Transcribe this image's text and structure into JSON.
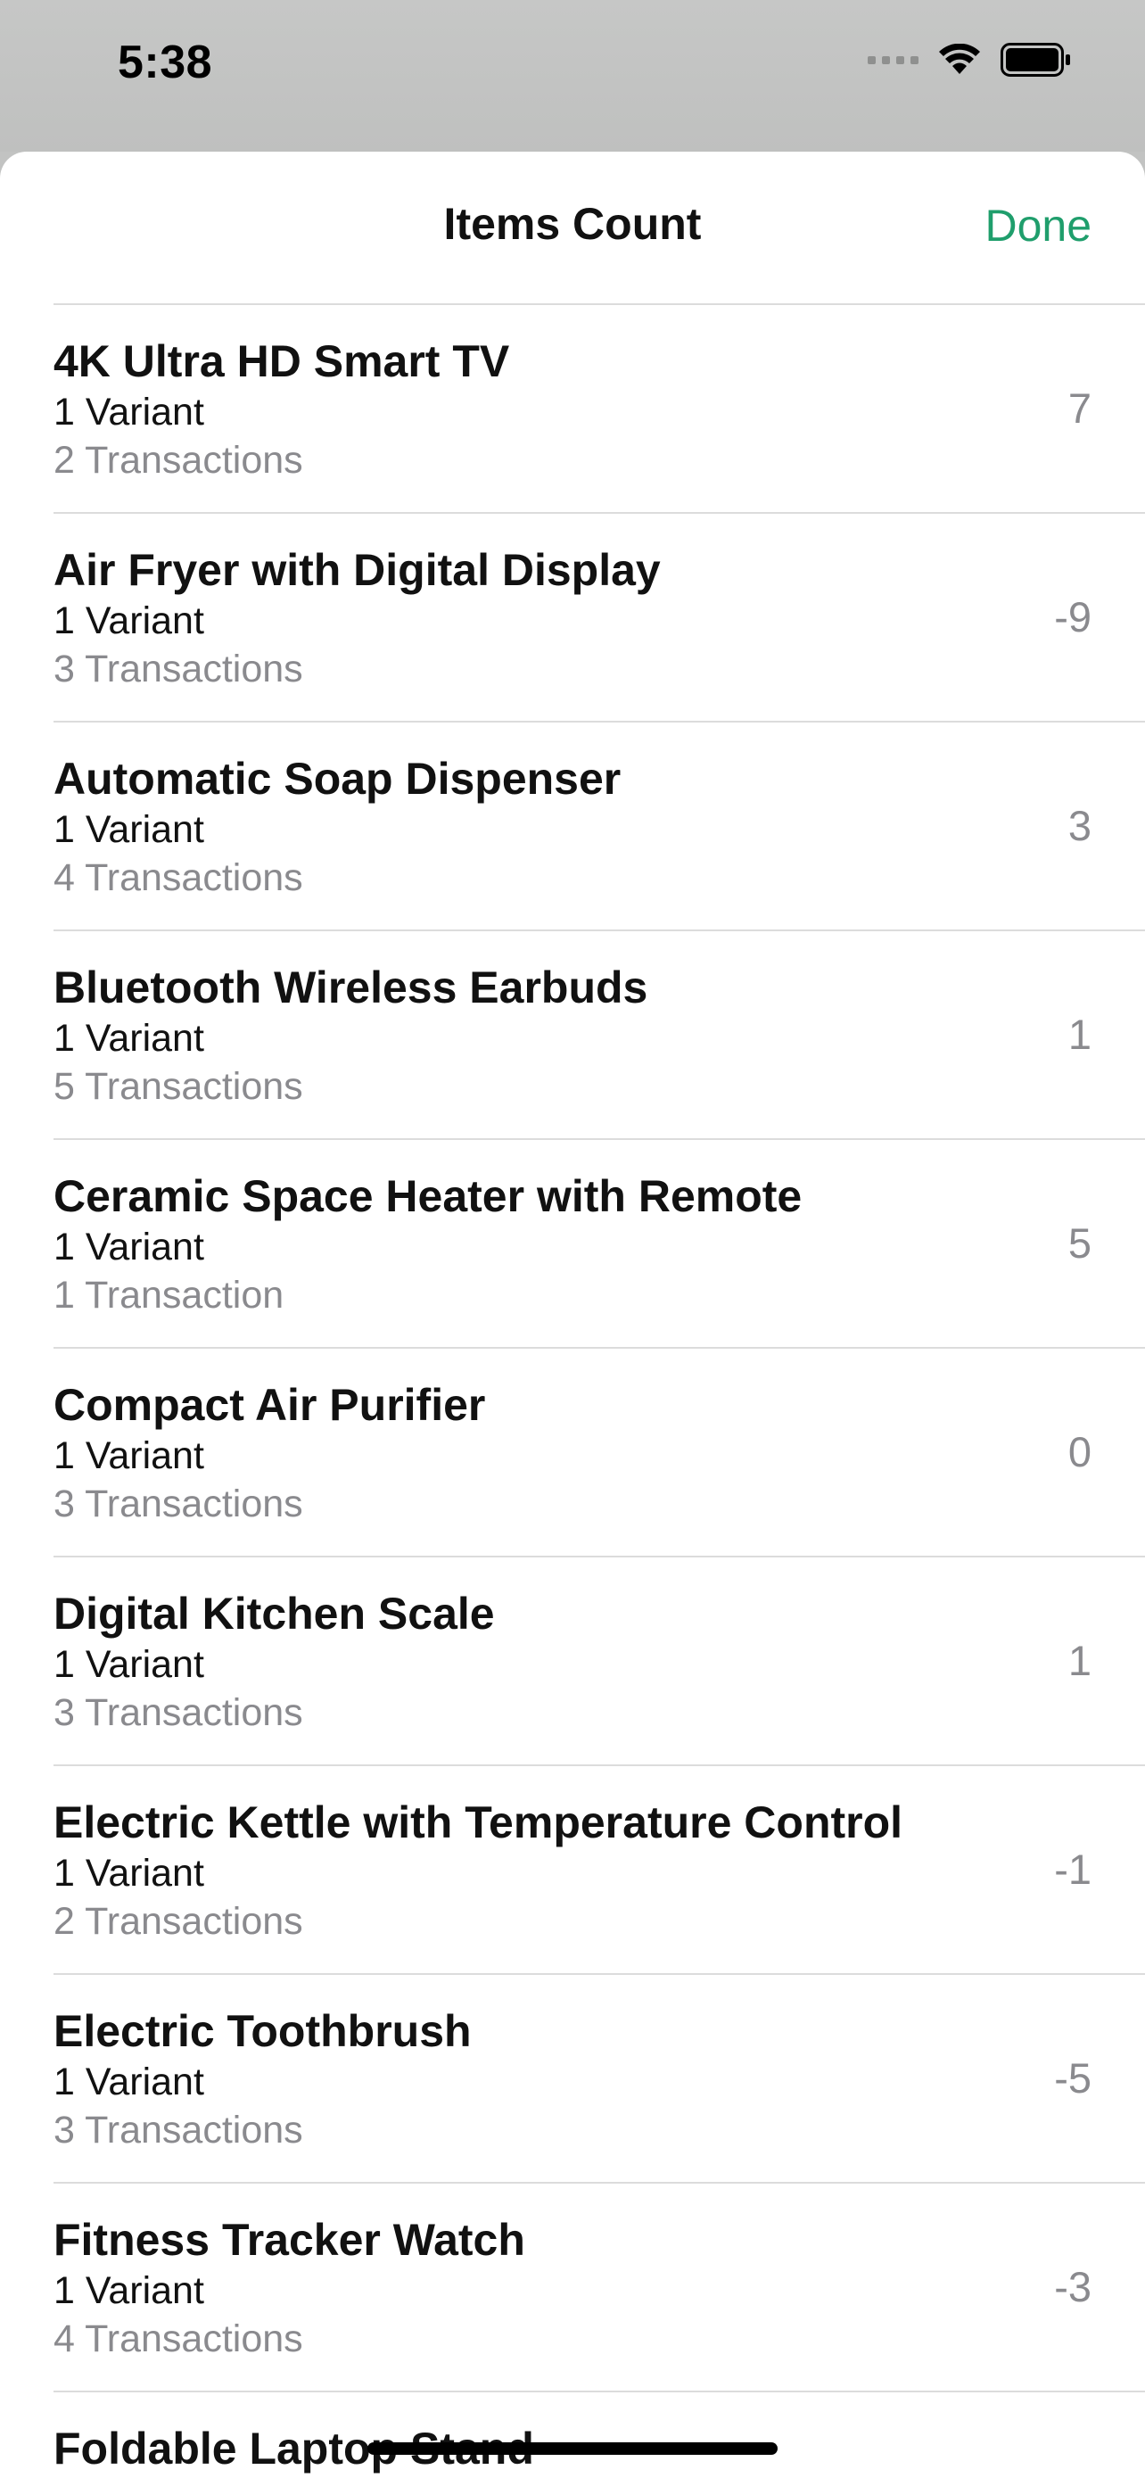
{
  "status_bar": {
    "time": "5:38"
  },
  "nav": {
    "title": "Items Count",
    "done_label": "Done"
  },
  "colors": {
    "accent": "#1f9e6c",
    "secondary_text": "#8a8a8e",
    "separator": "#dcdcdc"
  },
  "items": [
    {
      "name": "4K Ultra HD Smart TV",
      "variants": "1 Variant",
      "transactions": "2 Transactions",
      "count": "7"
    },
    {
      "name": "Air Fryer with Digital Display",
      "variants": "1 Variant",
      "transactions": "3 Transactions",
      "count": "-9"
    },
    {
      "name": "Automatic Soap Dispenser",
      "variants": "1 Variant",
      "transactions": "4 Transactions",
      "count": "3"
    },
    {
      "name": "Bluetooth Wireless Earbuds",
      "variants": "1 Variant",
      "transactions": "5 Transactions",
      "count": "1"
    },
    {
      "name": "Ceramic Space Heater with Remote",
      "variants": "1 Variant",
      "transactions": "1 Transaction",
      "count": "5"
    },
    {
      "name": "Compact Air Purifier",
      "variants": "1 Variant",
      "transactions": "3 Transactions",
      "count": "0"
    },
    {
      "name": "Digital Kitchen Scale",
      "variants": "1 Variant",
      "transactions": "3 Transactions",
      "count": "1"
    },
    {
      "name": "Electric Kettle with Temperature Control",
      "variants": "1 Variant",
      "transactions": "2 Transactions",
      "count": "-1"
    },
    {
      "name": "Electric Toothbrush",
      "variants": "1 Variant",
      "transactions": "3 Transactions",
      "count": "-5"
    },
    {
      "name": "Fitness Tracker Watch",
      "variants": "1 Variant",
      "transactions": "4 Transactions",
      "count": "-3"
    },
    {
      "name": "Foldable Laptop Stand",
      "variants": "",
      "transactions": "",
      "count": ""
    }
  ]
}
